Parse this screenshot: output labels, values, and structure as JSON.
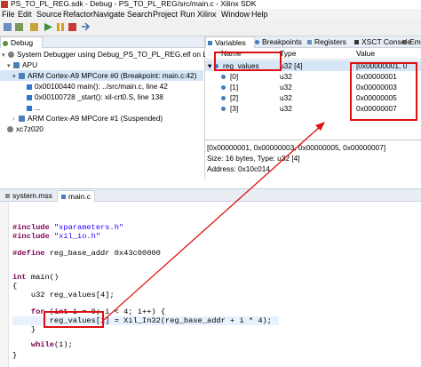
{
  "window": {
    "title": "PS_TO_PL_REG.sdk - Debug - PS_TO_PL_REG/src/main.c - Xilinx SDK"
  },
  "menu": [
    "File",
    "Edit",
    "Source",
    "Refactor",
    "Navigate",
    "Search",
    "Project",
    "Run",
    "Xilinx",
    "Window",
    "Help"
  ],
  "debug_view": {
    "tab_label": "Debug",
    "tree": [
      {
        "label": "System Debugger using Debug_PS_TO_PL_REG.elf on Local"
      },
      {
        "label": "APU"
      },
      {
        "label": "ARM Cortex-A9 MPCore #0 (Breakpoint: main.c:42)"
      },
      {
        "label": "0x00100440 main(): ../src/main.c, line 42"
      },
      {
        "label": "0x00100728 _start(): xil-crt0.S, line 138"
      },
      {
        "label": "..."
      },
      {
        "label": "ARM Cortex-A9 MPCore #1 (Suspended)"
      },
      {
        "label": "xc7z020"
      }
    ]
  },
  "variables_view": {
    "tabs": [
      "Variables",
      "Breakpoints",
      "Registers",
      "XSCT Console",
      "Emula"
    ],
    "columns": [
      "Name",
      "Type",
      "Value"
    ],
    "rows": [
      {
        "name": "reg_values",
        "type": "u32 [4]",
        "value": "[0x00000001, 0"
      },
      {
        "name": "[0]",
        "type": "u32",
        "value": "0x00000001"
      },
      {
        "name": "[1]",
        "type": "u32",
        "value": "0x00000003"
      },
      {
        "name": "[2]",
        "type": "u32",
        "value": "0x00000005"
      },
      {
        "name": "[3]",
        "type": "u32",
        "value": "0x00000007"
      }
    ],
    "detail": {
      "line1": "[0x00000001, 0x00000003, 0x00000005, 0x00000007]",
      "line2": "Size: 16 bytes, Type: u32 [4]",
      "line3": "Address: 0x10c014"
    }
  },
  "editor": {
    "tabs": [
      "system.mss",
      "main.c"
    ],
    "code": {
      "l1_pp": "#include",
      "l1_str": "\"xparameters.h\"",
      "l2_pp": "#include",
      "l2_str": "\"xil_io.h\"",
      "l3_pp": "#define",
      "l3_rest": " reg_base_addr 0x43c00000",
      "l4_kw": "int",
      "l4_rest": " main()",
      "l5": "{",
      "l6": "    u32 reg_values[4];",
      "l7_kw": "for",
      "l7_open": "    ",
      "l7_a": " (",
      "l7_kw2": "int",
      "l7_rest": " i = 0; i < 4; i++) {",
      "l8_target": "reg_values[i]",
      "l8_rest": " = Xil_In32(reg_base_addr + i * 4);",
      "l9": "    }",
      "l10_kw": "while",
      "l10_rest": "(1);",
      "l11": "}"
    }
  },
  "colors": {
    "annotation": "#e01010",
    "selection": "#d6e6f7",
    "keyword": "#7f0055",
    "string": "#2a00ff"
  }
}
